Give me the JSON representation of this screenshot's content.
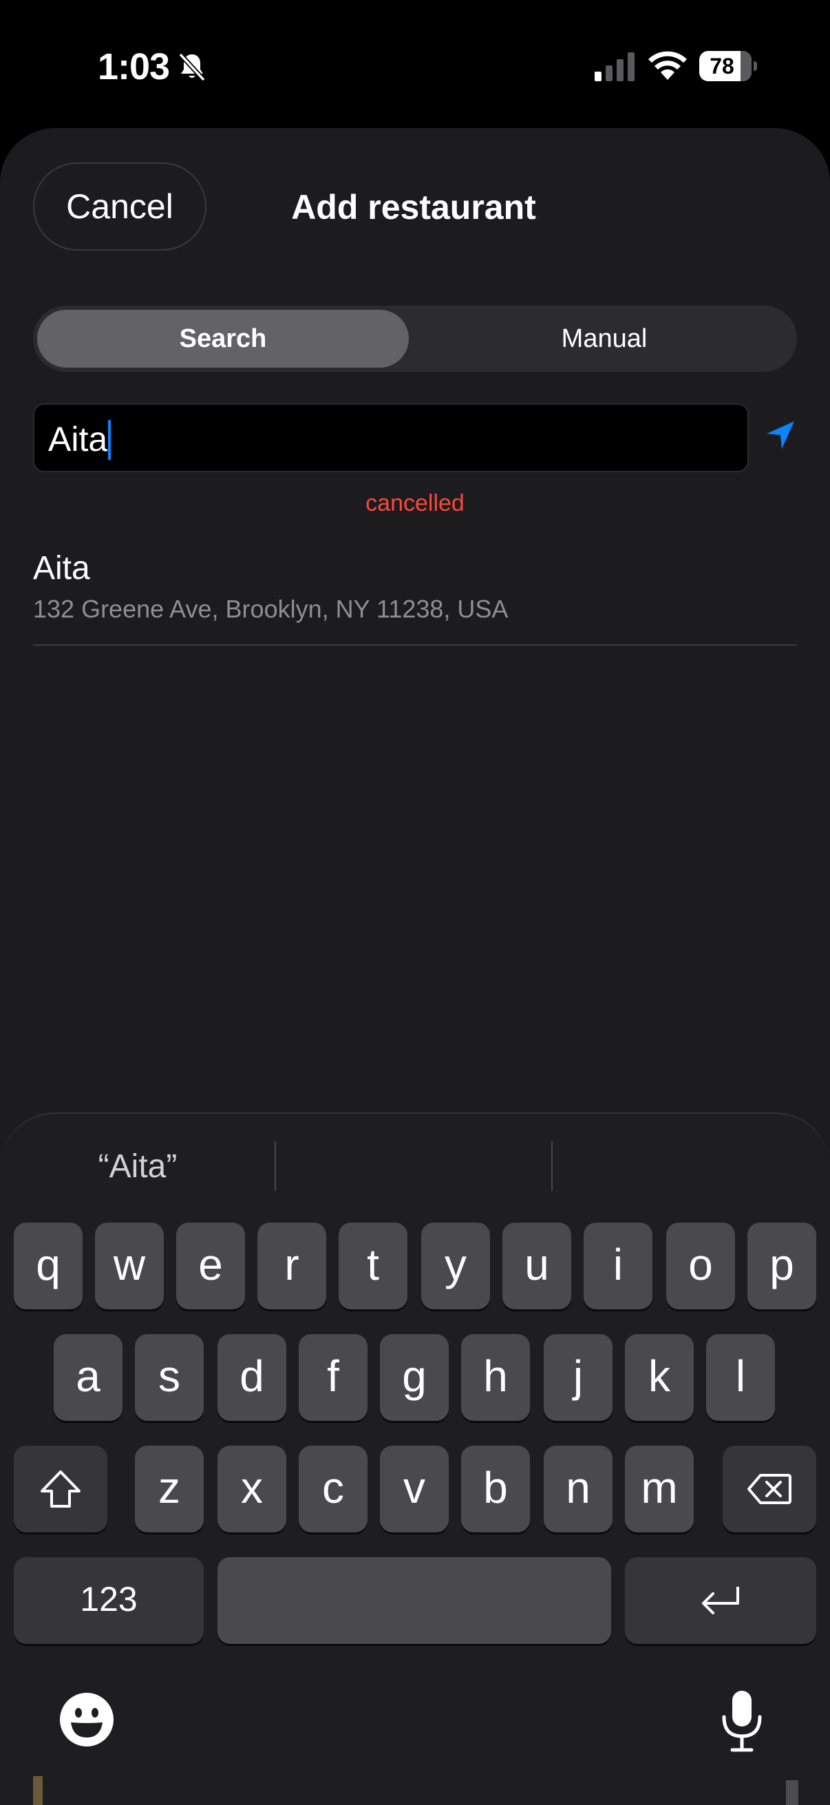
{
  "status_bar": {
    "time": "1:03",
    "battery": "78",
    "icons": [
      "bell-slash-icon",
      "cellular-signal-icon",
      "wifi-icon",
      "battery-icon"
    ]
  },
  "header": {
    "cancel_label": "Cancel",
    "title": "Add restaurant"
  },
  "segments": {
    "search_label": "Search",
    "manual_label": "Manual",
    "selected": "Search"
  },
  "search": {
    "value": "Aita",
    "location_icon": "location-arrow-icon"
  },
  "status_message": "cancelled",
  "results": [
    {
      "name": "Aita",
      "address": "132 Greene Ave, Brooklyn, NY 11238, USA"
    }
  ],
  "keyboard": {
    "suggestions": [
      "“Aita”",
      "",
      ""
    ],
    "row1": [
      "q",
      "w",
      "e",
      "r",
      "t",
      "y",
      "u",
      "i",
      "o",
      "p"
    ],
    "row2": [
      "a",
      "s",
      "d",
      "f",
      "g",
      "h",
      "j",
      "k",
      "l"
    ],
    "row3": [
      "z",
      "x",
      "c",
      "v",
      "b",
      "n",
      "m"
    ],
    "numbers_label": "123",
    "icons": [
      "shift-icon",
      "backspace-icon",
      "return-icon",
      "emoji-icon",
      "microphone-icon"
    ]
  },
  "colors": {
    "accent": "#0a84ff",
    "error": "#ff453a",
    "sheet": "#1c1c1e",
    "key": "#4a4a4d"
  }
}
